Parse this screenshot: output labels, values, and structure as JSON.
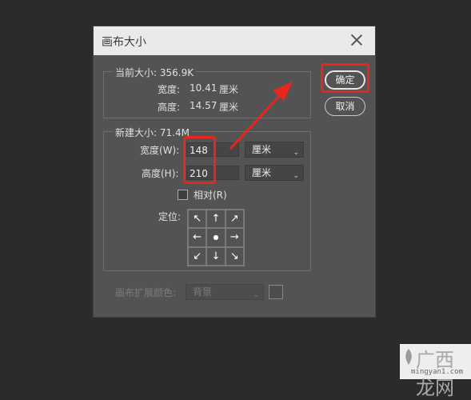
{
  "dialog": {
    "title": "画布大小",
    "current": {
      "legend": "当前大小: 356.9K",
      "width_label": "宽度:",
      "width_value": "10.41",
      "height_label": "高度:",
      "height_value": "14.57",
      "unit": "厘米"
    },
    "new_size": {
      "legend": "新建大小: 71.4M",
      "width_label": "宽度(W):",
      "width_value": "148",
      "height_label": "高度(H):",
      "height_value": "210",
      "width_unit": "厘米",
      "height_unit": "厘米",
      "relative_label": "相对(R)",
      "relative_checked": false,
      "anchor_label": "定位:",
      "anchor_arrows": [
        "↖",
        "↑",
        "↗",
        "←",
        "●",
        "→",
        "↙",
        "↓",
        "↘"
      ]
    },
    "extension": {
      "label": "画布扩展颜色:",
      "value": "背景"
    },
    "buttons": {
      "ok": "确定",
      "cancel": "取消"
    }
  },
  "watermark": {
    "text": "广西龙网",
    "url": "mingyan1.com"
  },
  "colors": {
    "annotation_red": "#e8261d",
    "dialog_bg": "#535353",
    "page_bg": "#2b2b2b"
  }
}
